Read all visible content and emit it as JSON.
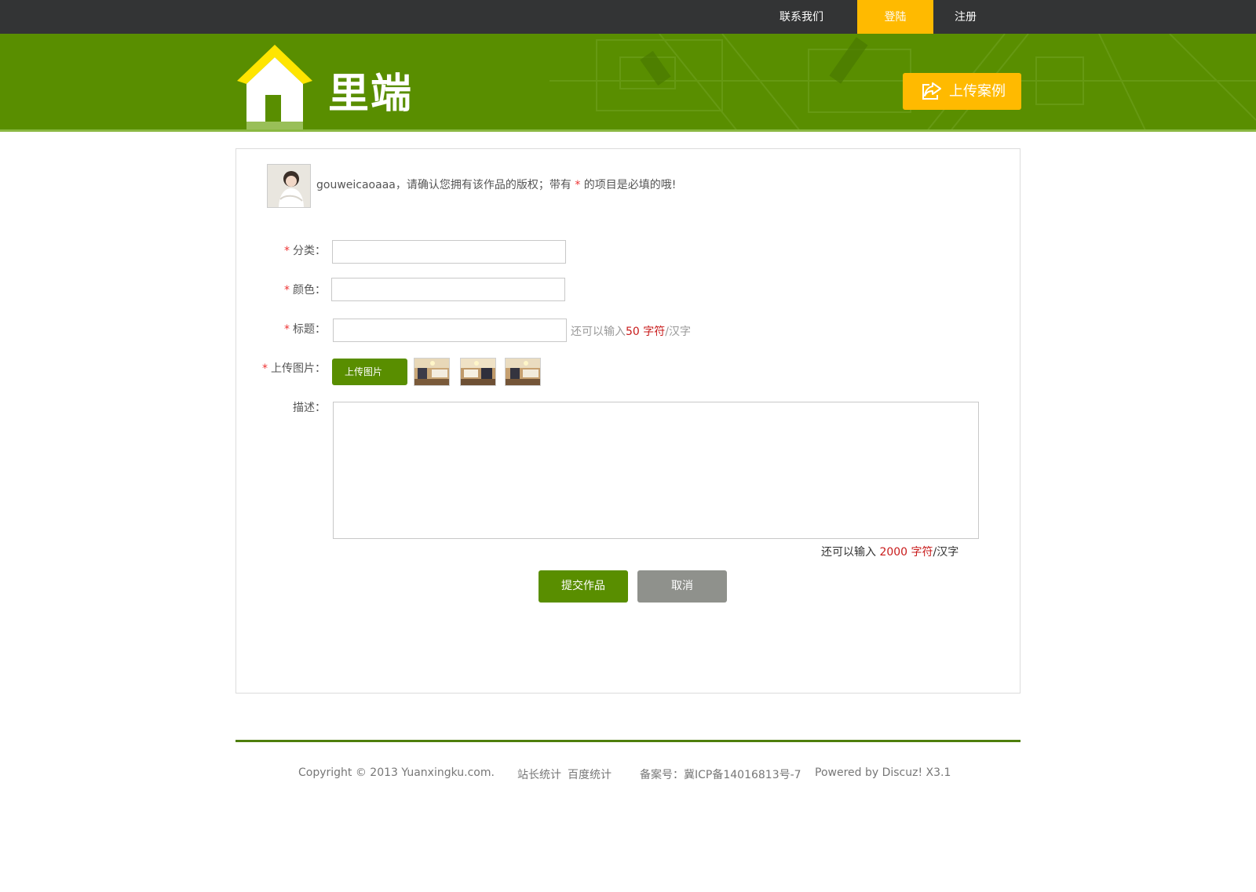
{
  "nav": {
    "contact": "联系我们",
    "login": "登陆",
    "register": "注册"
  },
  "logo": {
    "text": "里端"
  },
  "upload_case": {
    "label": "上传案例",
    "icon": "share-icon"
  },
  "notice": {
    "username": "gouweicaoaaa",
    "part1": "，请确认您拥有该作品的版权；带有",
    "star": "*",
    "part2": "的项目是必填的哦!"
  },
  "form": {
    "star": "*",
    "category_label": "分类：",
    "category_value": "",
    "color_label": "颜色：",
    "color_value": "",
    "title_label": "标题：",
    "title_value": "",
    "title_hint_prefix": "还可以输入",
    "title_hint_count": "50 字符",
    "title_hint_suffix": "/汉字",
    "image_label": "上传图片：",
    "image_button": "上传图片",
    "thumbnails": [
      "thumb-1",
      "thumb-2",
      "thumb-3"
    ],
    "desc_label": "描述：",
    "desc_value": "",
    "desc_hint_prefix": "还可以输入",
    "desc_hint_count": "2000 字符",
    "desc_hint_suffix": "/汉字",
    "submit": "提交作品",
    "cancel": "取消"
  },
  "footer": {
    "copyright": "Copyright © 2013 Yuanxingku.com.",
    "stats1": "站长统计",
    "stats2": "百度统计",
    "icp": "备案号：冀ICP备14016813号-7",
    "powered": "Powered by Discuz! X3.1"
  },
  "colors": {
    "green": "#598e00",
    "yellow": "#ffba00",
    "dark": "#333435",
    "gray_button": "#8f918c",
    "red": "#c81a1a"
  }
}
